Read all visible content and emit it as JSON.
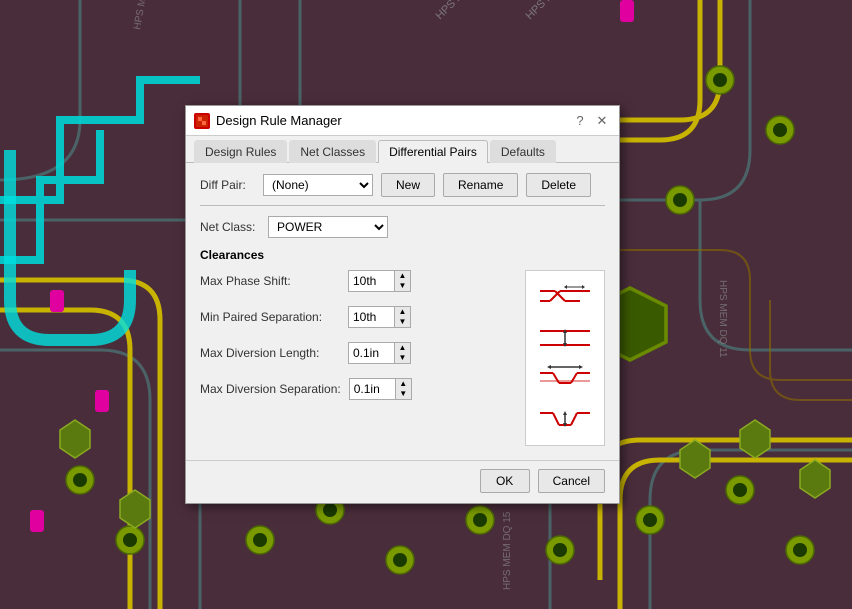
{
  "dialog": {
    "title": "Design Rule Manager",
    "icon_label": "DRM",
    "tabs": [
      {
        "id": "design-rules",
        "label": "Design Rules",
        "active": false
      },
      {
        "id": "net-classes",
        "label": "Net Classes",
        "active": false
      },
      {
        "id": "differential-pairs",
        "label": "Differential Pairs",
        "active": true
      },
      {
        "id": "defaults",
        "label": "Defaults",
        "active": false
      }
    ],
    "diff_pair": {
      "label": "Diff Pair:",
      "value": "(None)",
      "options": [
        "(None)"
      ]
    },
    "buttons": {
      "new": "New",
      "rename": "Rename",
      "delete": "Delete"
    },
    "net_class": {
      "label": "Net Class:",
      "value": "POWER"
    },
    "clearances": {
      "header": "Clearances",
      "fields": [
        {
          "label": "Max Phase Shift:",
          "value": "10th",
          "id": "max-phase-shift"
        },
        {
          "label": "Min Paired Separation:",
          "value": "10th",
          "id": "min-paired-sep"
        },
        {
          "label": "Max Diversion Length:",
          "value": "0.1in",
          "id": "max-div-length"
        },
        {
          "label": "Max Diversion Separation:",
          "value": "0.1in",
          "id": "max-div-sep"
        }
      ]
    },
    "footer": {
      "ok": "OK",
      "cancel": "Cancel"
    }
  }
}
